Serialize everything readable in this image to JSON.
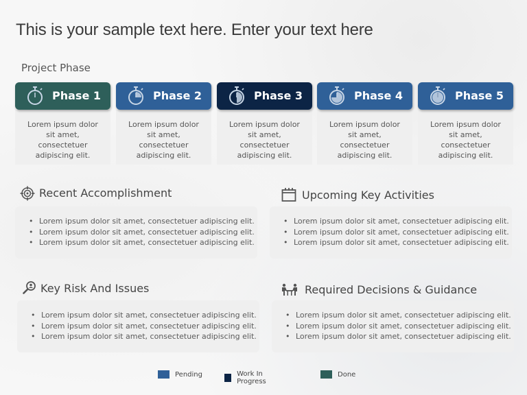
{
  "title": "This is your sample text here. Enter your text here",
  "section_label": "Project Phase",
  "colors": {
    "done": "#2e5f5a",
    "pending": "#2f6098",
    "work_in_progress": "#0c2445",
    "icon_light": "#c8d6e6"
  },
  "phases": [
    {
      "label": "Phase 1",
      "status": "done",
      "icon": "stopwatch-empty-icon",
      "progress": 0,
      "description": "Lorem ipsum dolor sit amet, consectetuer adipiscing elit."
    },
    {
      "label": "Phase 2",
      "status": "pending",
      "icon": "stopwatch-quarter-icon",
      "progress": 0.25,
      "description": "Lorem ipsum dolor sit amet, consectetuer adipiscing elit."
    },
    {
      "label": "Phase 3",
      "status": "work_in_progress",
      "icon": "stopwatch-half-icon",
      "progress": 0.5,
      "description": "Lorem ipsum dolor sit amet, consectetuer adipiscing elit."
    },
    {
      "label": "Phase 4",
      "status": "pending",
      "icon": "stopwatch-three-quarter-icon",
      "progress": 0.75,
      "description": "Lorem ipsum dolor sit amet, consectetuer adipiscing elit."
    },
    {
      "label": "Phase 5",
      "status": "pending",
      "icon": "stopwatch-full-icon",
      "progress": 1,
      "description": "Lorem ipsum dolor sit amet, consectetuer adipiscing elit."
    }
  ],
  "sections": {
    "recent_accomplishment": {
      "title": "Recent Accomplishment",
      "icon": "target-icon",
      "items": [
        "Lorem ipsum dolor sit amet, consectetuer adipiscing elit.",
        "Lorem ipsum dolor sit amet, consectetuer adipiscing elit.",
        "Lorem ipsum dolor sit amet, consectetuer adipiscing elit."
      ]
    },
    "upcoming_key_activities": {
      "title": "Upcoming Key Activities",
      "icon": "calendar-icon",
      "items": [
        "Lorem ipsum dolor sit amet, consectetuer adipiscing elit.",
        "Lorem ipsum dolor sit amet, consectetuer adipiscing elit.",
        "Lorem ipsum dolor sit amet, consectetuer adipiscing elit."
      ]
    },
    "key_risk_and_issues": {
      "title": "Key Risk And Issues",
      "icon": "search-person-icon",
      "items": [
        "Lorem ipsum dolor sit amet, consectetuer adipiscing elit.",
        "Lorem ipsum dolor sit amet, consectetuer adipiscing elit.",
        "Lorem ipsum dolor sit amet, consectetuer adipiscing elit."
      ]
    },
    "required_decisions": {
      "title": "Required Decisions & Guidance",
      "icon": "meeting-icon",
      "items": [
        "Lorem ipsum dolor sit amet, consectetuer adipiscing elit.",
        "Lorem ipsum dolor sit amet, consectetuer adipiscing elit.",
        "Lorem ipsum dolor sit amet, consectetuer adipiscing elit."
      ]
    }
  },
  "legend": [
    {
      "label": "Pending",
      "status": "pending"
    },
    {
      "label": "Work In Progress",
      "status": "work_in_progress"
    },
    {
      "label": "Done",
      "status": "done"
    }
  ]
}
